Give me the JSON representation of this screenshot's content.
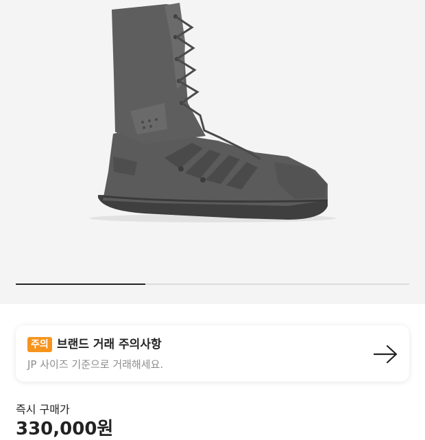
{
  "product_image": {
    "icon": "boot-image",
    "gallery_progress": 0.33
  },
  "notice": {
    "badge": "주의",
    "title": "브랜드 거래 주의사항",
    "subtitle": "JP 사이즈 기준으로 거래해세요.",
    "icon": "arrow-right-icon",
    "badge_color": "#f7941d"
  },
  "price": {
    "label": "즉시 구매가",
    "value": "330,000원"
  }
}
